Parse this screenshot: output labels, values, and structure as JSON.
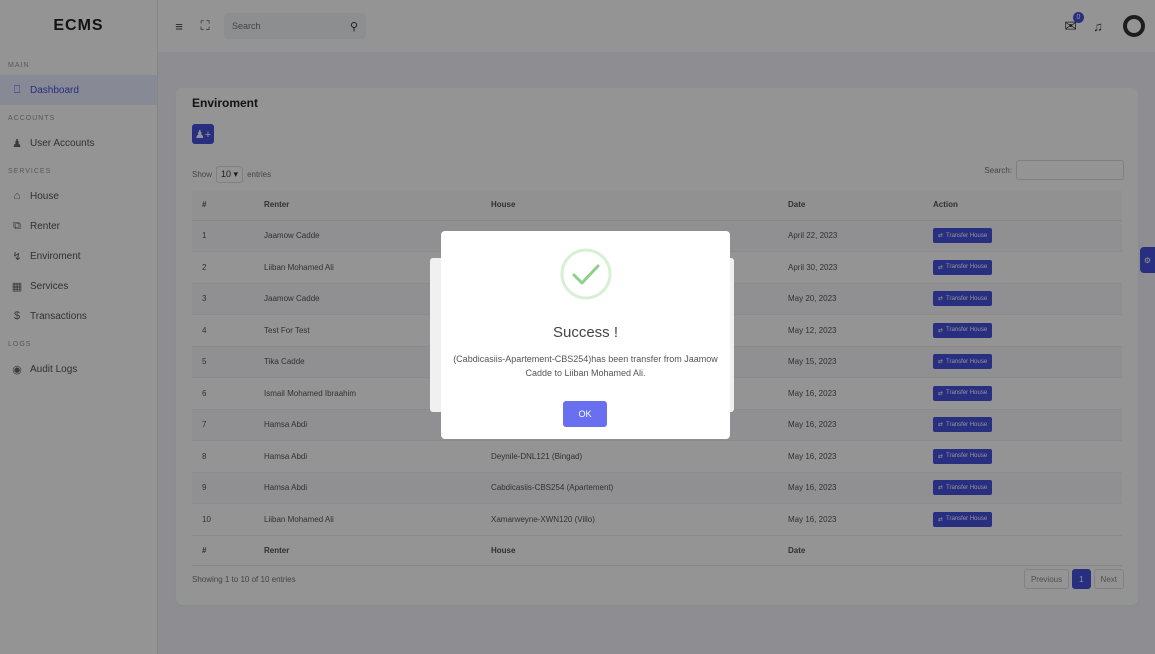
{
  "sidebar": {
    "logo": "ECMS",
    "sections": {
      "main": "MAIN",
      "accounts": "ACCOUNTS",
      "services": "SERVICES",
      "logs": "LOGS"
    },
    "items": [
      {
        "label": "Dashboard",
        "icon": "monitor-icon"
      },
      {
        "label": "User Accounts",
        "icon": "user-icon"
      },
      {
        "label": "House",
        "icon": "home-icon"
      },
      {
        "label": "Renter",
        "icon": "copy-icon"
      },
      {
        "label": "Enviroment",
        "icon": "lightning-icon"
      },
      {
        "label": "Services",
        "icon": "building-icon"
      },
      {
        "label": "Transactions",
        "icon": "dollar-icon"
      },
      {
        "label": "Audit Logs",
        "icon": "globe-icon"
      }
    ]
  },
  "topbar": {
    "search_placeholder": "Search",
    "notification_count": "0"
  },
  "card": {
    "title": "Enviroment",
    "show_label": "Show",
    "entries_value": "10",
    "entries_label": "entries",
    "search_label": "Search:"
  },
  "table": {
    "headers": [
      "#",
      "Renter",
      "House",
      "Date",
      "Action"
    ],
    "rows": [
      {
        "num": "1",
        "renter": "Jaamow Cadde",
        "house": "",
        "date": "April 22, 2023",
        "action": "Transfer House"
      },
      {
        "num": "2",
        "renter": "Liiban Mohamed Ali",
        "house": "",
        "date": "April 30, 2023",
        "action": "Transfer House"
      },
      {
        "num": "3",
        "renter": "Jaamow Cadde",
        "house": "",
        "date": "May 20, 2023",
        "action": "Transfer House"
      },
      {
        "num": "4",
        "renter": "Test For Test",
        "house": "",
        "date": "May 12, 2023",
        "action": "Transfer House"
      },
      {
        "num": "5",
        "renter": "Tika Cadde",
        "house": "",
        "date": "May 15, 2023",
        "action": "Transfer House"
      },
      {
        "num": "6",
        "renter": "Ismail Mohamed Ibraahim",
        "house": "",
        "date": "May 16, 2023",
        "action": "Transfer House"
      },
      {
        "num": "7",
        "renter": "Hamsa Abdi",
        "house": "",
        "date": "May 16, 2023",
        "action": "Transfer House"
      },
      {
        "num": "8",
        "renter": "Hamsa Abdi",
        "house": "Deynile-DNL121 (Bingad)",
        "date": "May 16, 2023",
        "action": "Transfer House"
      },
      {
        "num": "9",
        "renter": "Hamsa Abdi",
        "house": "Cabdicasiis-CBS254 (Apartement)",
        "date": "May 16, 2023",
        "action": "Transfer House"
      },
      {
        "num": "10",
        "renter": "Liiban Mohamed Ali",
        "house": "Xamarweyne-XWN120 (Villo)",
        "date": "May 16, 2023",
        "action": "Transfer House"
      }
    ],
    "footer": [
      "#",
      "Renter",
      "House",
      "Date",
      ""
    ],
    "info": "Showing 1 to 10 of 10 entries",
    "pager": {
      "previous": "Previous",
      "current": "1",
      "next": "Next"
    }
  },
  "modal": {
    "title": "Success !",
    "message": "(Cabdicasiis-Apartement-CBS254)has been transfer from Jaamow Cadde to Liiban Mohamed Ali.",
    "ok_label": "OK"
  },
  "colors": {
    "accent": "#4650dd",
    "success": "#8ed28a"
  }
}
